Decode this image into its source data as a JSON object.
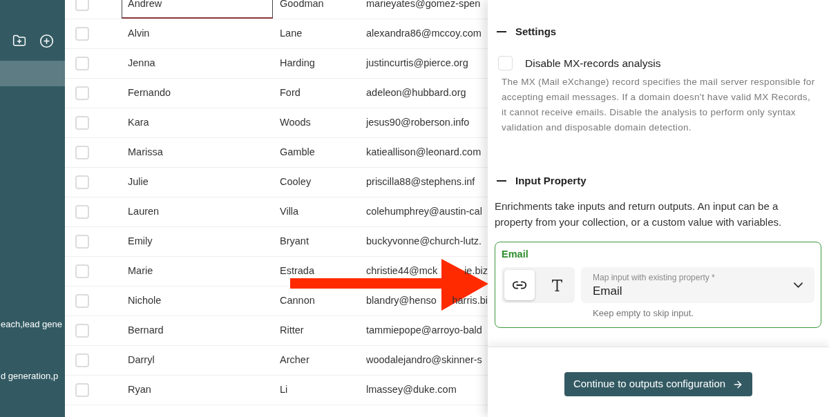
{
  "sidebar": {
    "items": [
      {
        "selected": true
      }
    ],
    "text_lines": [
      "each,lead gene",
      "d generation,p"
    ]
  },
  "table": {
    "rows": [
      {
        "checked": false,
        "editing": true,
        "first_name": "Andrew",
        "last_name": "Goodman",
        "email": [
          "marieyates@gomez-spen"
        ]
      },
      {
        "checked": false,
        "editing": false,
        "first_name": "Alvin",
        "last_name": "Lane",
        "email": [
          "alexandra86@mccoy.com"
        ]
      },
      {
        "checked": false,
        "editing": false,
        "first_name": "Jenna",
        "last_name": "Harding",
        "email": [
          "justincurtis@pierce.org"
        ]
      },
      {
        "checked": false,
        "editing": false,
        "first_name": "Fernando",
        "last_name": "Ford",
        "email": [
          "adeleon@hubbard.org"
        ]
      },
      {
        "checked": false,
        "editing": false,
        "first_name": "Kara",
        "last_name": "Woods",
        "email": [
          "jesus90@roberson.info"
        ]
      },
      {
        "checked": false,
        "editing": false,
        "first_name": "Marissa",
        "last_name": "Gamble",
        "email": [
          "katieallison@leonard.com"
        ]
      },
      {
        "checked": false,
        "editing": false,
        "first_name": "Julie",
        "last_name": "Cooley",
        "email": [
          "priscilla88@stephens.inf"
        ]
      },
      {
        "checked": false,
        "editing": false,
        "first_name": "Lauren",
        "last_name": "Villa",
        "email": [
          "colehumphrey@austin-cal"
        ]
      },
      {
        "checked": false,
        "editing": false,
        "first_name": "Emily",
        "last_name": "Bryant",
        "email": [
          "buckyvonne@church-lutz."
        ]
      },
      {
        "checked": false,
        "editing": false,
        "first_name": "Marie",
        "last_name": "Estrada",
        "email": [
          "christie44@mck",
          "ie.biz"
        ]
      },
      {
        "checked": false,
        "editing": false,
        "first_name": "Nichole",
        "last_name": "Cannon",
        "email": [
          "blandry@henso",
          "harris.bi"
        ]
      },
      {
        "checked": false,
        "editing": false,
        "first_name": "Bernard",
        "last_name": "Ritter",
        "email": [
          "tammiepope@arroyo-bald"
        ]
      },
      {
        "checked": false,
        "editing": false,
        "first_name": "Darryl",
        "last_name": "Archer",
        "email": [
          "woodalejandro@skinner-s"
        ]
      },
      {
        "checked": false,
        "editing": false,
        "first_name": "Ryan",
        "last_name": "Li",
        "email": [
          "lmassey@duke.com"
        ]
      }
    ]
  },
  "panel": {
    "settings": {
      "title": "Settings",
      "expanded": true,
      "option": {
        "label": "Disable MX-records analysis",
        "checked": false
      },
      "description": "The MX (Mail eXchange) record specifies the mail server responsible for accepting email messages. If a domain doesn't have valid MX Records, it cannot receive emails. Disable the analysis to perform only syntax validation and disposable domain detection."
    },
    "input_property": {
      "title": "Input Property",
      "expanded": true,
      "intro": "Enrichments take inputs and return outputs. An input can be a property from your collection, or a custom value with variables.",
      "field": {
        "name": "Email",
        "modes": [
          {
            "kind": "link",
            "selected": true
          },
          {
            "kind": "text",
            "selected": false
          }
        ],
        "select": {
          "label": "Map input with existing property *",
          "value": "Email"
        },
        "hint": "Keep empty to skip input."
      }
    },
    "footer": {
      "button": "Continue to outputs configuration"
    }
  }
}
